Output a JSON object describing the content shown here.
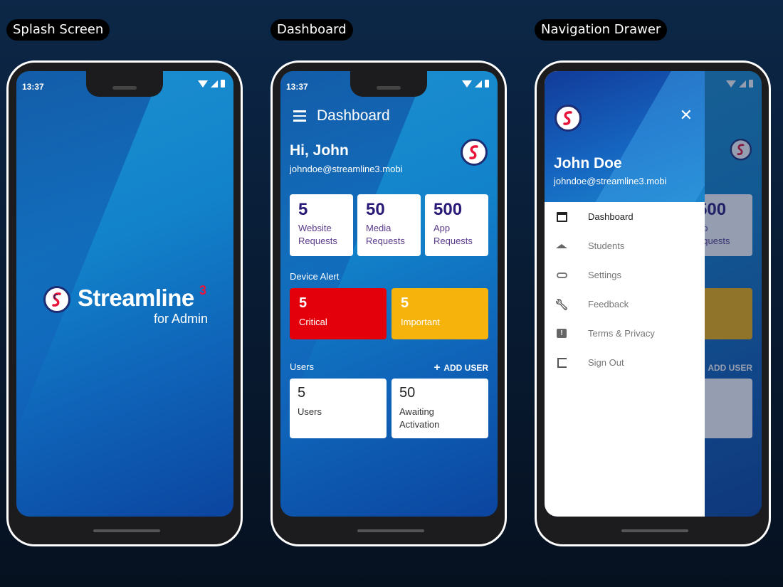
{
  "labels": {
    "splash": "Splash Screen",
    "dashboard": "Dashboard",
    "drawer": "Navigation Drawer"
  },
  "status": {
    "time": "13:37"
  },
  "splash": {
    "brand": "Streamline",
    "superscript": "3",
    "subtitle": "for Admin"
  },
  "dashboard": {
    "title": "Dashboard",
    "greeting": "Hi, John",
    "email": "johndoe@streamline3.mobi",
    "requests": [
      {
        "value": "5",
        "label": "Website\nRequests"
      },
      {
        "value": "50",
        "label": "Media\nRequests"
      },
      {
        "value": "500",
        "label": "App\nRequests"
      }
    ],
    "device_alert_label": "Device Alert",
    "alerts": [
      {
        "value": "5",
        "label": "Critical",
        "color": "#e3000b"
      },
      {
        "value": "5",
        "label": "Important",
        "color": "#f6b30c"
      }
    ],
    "users_label": "Users",
    "add_user": "ADD USER",
    "users": [
      {
        "value": "5",
        "label": "Users"
      },
      {
        "value": "50",
        "label": "Awaiting\nActivation"
      }
    ]
  },
  "drawer": {
    "name": "John Doe",
    "email": "johndoe@streamline3.mobi",
    "items": [
      {
        "label": "Dashboard",
        "icon": "dashboard-icon"
      },
      {
        "label": "Students",
        "icon": "graduation-cap-icon"
      },
      {
        "label": "Settings",
        "icon": "link-icon"
      },
      {
        "label": "Feedback",
        "icon": "wrench-icon"
      },
      {
        "label": "Terms & Privacy",
        "icon": "feedback-icon"
      },
      {
        "label": "Sign Out",
        "icon": "sign-out-icon"
      }
    ],
    "behind": {
      "stat_value": "500",
      "stat_label_1": "pp",
      "stat_label_2": "equests",
      "add_user": "ADD USER"
    }
  },
  "colors": {
    "accent_dark": "#2a1a78",
    "critical": "#e3000b",
    "important": "#f6b30c",
    "logo_red": "#e8143a"
  }
}
